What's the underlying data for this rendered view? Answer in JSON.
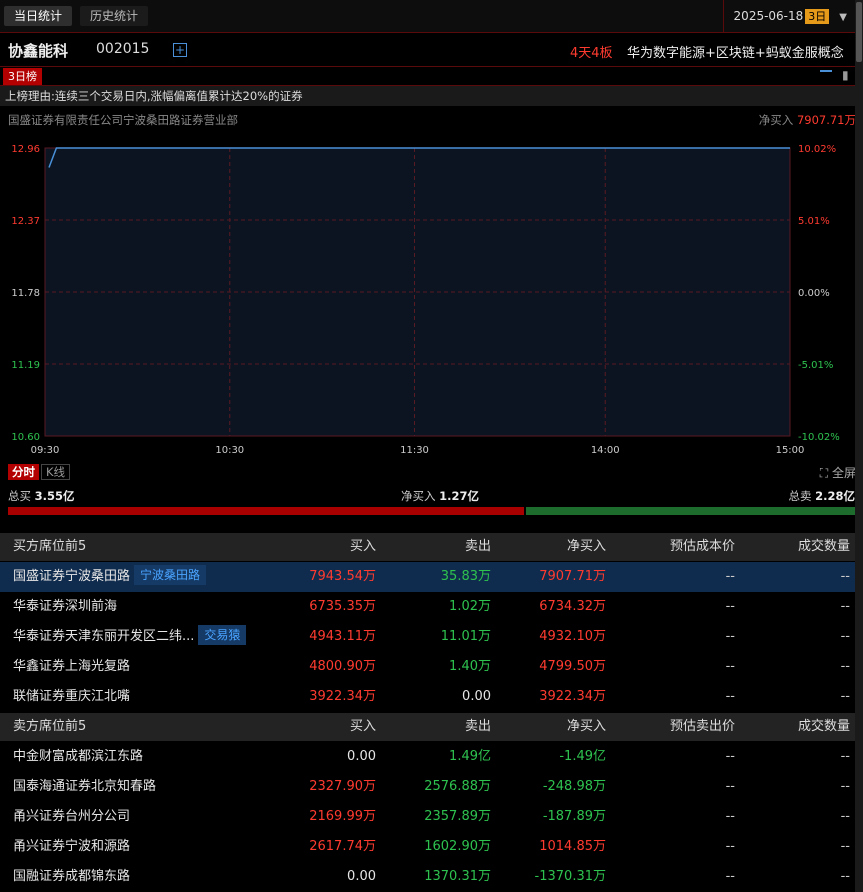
{
  "topbar": {
    "tab_today": "当日统计",
    "tab_history": "历史统计",
    "date": "2025-06-18",
    "period_badge": "3日"
  },
  "stock": {
    "name": "协鑫能科",
    "code": "002015",
    "boards": "4天4板",
    "concept": "华为数字能源+区块链+蚂蚁金服概念"
  },
  "list_tag": "3日榜",
  "reason": "上榜理由:连续三个交易日内,涨幅偏离值累计达20%的证券",
  "broker": {
    "name": "国盛证券有限责任公司宁波桑田路证券营业部",
    "net_label": "净买入",
    "net_value": "7907.71万"
  },
  "chart_data": {
    "type": "line",
    "x_ticks": [
      "09:30",
      "10:30",
      "11:30",
      "14:00",
      "15:00"
    ],
    "y_left_ticks": [
      "12.96",
      "12.37",
      "11.78",
      "11.19",
      "10.60"
    ],
    "y_right_ticks": [
      "10.02%",
      "5.01%",
      "0.00%",
      "-5.01%",
      "-10.02%"
    ],
    "ylim": [
      10.6,
      12.96
    ],
    "series": [
      {
        "values": [
          12.8,
          12.96,
          12.96,
          12.96,
          12.96,
          12.96
        ]
      }
    ],
    "x": [
      0,
      0.01,
      0.25,
      0.5,
      0.75,
      1.0
    ],
    "grid": true,
    "colors": {
      "line": "#4a90d9",
      "grid": "#5a1a24",
      "up": "#ff3b30",
      "down": "#2ec24f"
    }
  },
  "chart_tabs": {
    "intraday": "分时",
    "kline": "K线",
    "fullscreen": "全屏"
  },
  "summary": {
    "total_buy_label": "总买",
    "total_buy": "3.55亿",
    "net_buy_label": "净买入",
    "net_buy": "1.27亿",
    "total_sell_label": "总卖",
    "total_sell": "2.28亿",
    "buy_fraction": 0.609
  },
  "buy_table": {
    "headers": [
      "买方席位前5",
      "买入",
      "卖出",
      "净买入",
      "预估成本价",
      "成交数量"
    ],
    "rows": [
      {
        "name": "国盛证券宁波桑田路",
        "tag": "宁波桑田路",
        "buy": "7943.54万",
        "sell": "35.83万",
        "net": "7907.71万",
        "cost": "--",
        "vol": "--",
        "net_sign": "up"
      },
      {
        "name": "华泰证券深圳前海",
        "tag": "",
        "buy": "6735.35万",
        "sell": "1.02万",
        "net": "6734.32万",
        "cost": "--",
        "vol": "--",
        "net_sign": "up"
      },
      {
        "name": "华泰证券天津东丽开发区二纬...",
        "tag": "交易猿",
        "buy": "4943.11万",
        "sell": "11.01万",
        "net": "4932.10万",
        "cost": "--",
        "vol": "--",
        "net_sign": "up"
      },
      {
        "name": "华鑫证券上海光复路",
        "tag": "",
        "buy": "4800.90万",
        "sell": "1.40万",
        "net": "4799.50万",
        "cost": "--",
        "vol": "--",
        "net_sign": "up"
      },
      {
        "name": "联储证券重庆江北嘴",
        "tag": "",
        "buy": "3922.34万",
        "sell": "0.00",
        "net": "3922.34万",
        "cost": "--",
        "vol": "--",
        "net_sign": "up"
      }
    ]
  },
  "sell_table": {
    "headers": [
      "卖方席位前5",
      "买入",
      "卖出",
      "净买入",
      "预估卖出价",
      "成交数量"
    ],
    "rows": [
      {
        "name": "中金财富成都滨江东路",
        "buy": "0.00",
        "sell": "1.49亿",
        "net": "-1.49亿",
        "cost": "--",
        "vol": "--",
        "net_sign": "down"
      },
      {
        "name": "国泰海通证券北京知春路",
        "buy": "2327.90万",
        "sell": "2576.88万",
        "net": "-248.98万",
        "cost": "--",
        "vol": "--",
        "net_sign": "down"
      },
      {
        "name": "甬兴证券台州分公司",
        "buy": "2169.99万",
        "sell": "2357.89万",
        "net": "-187.89万",
        "cost": "--",
        "vol": "--",
        "net_sign": "down"
      },
      {
        "name": "甬兴证券宁波和源路",
        "buy": "2617.74万",
        "sell": "1602.90万",
        "net": "1014.85万",
        "cost": "--",
        "vol": "--",
        "net_sign": "up"
      },
      {
        "name": "国融证券成都锦东路",
        "buy": "0.00",
        "sell": "1370.31万",
        "net": "-1370.31万",
        "cost": "--",
        "vol": "--",
        "net_sign": "down"
      }
    ]
  }
}
